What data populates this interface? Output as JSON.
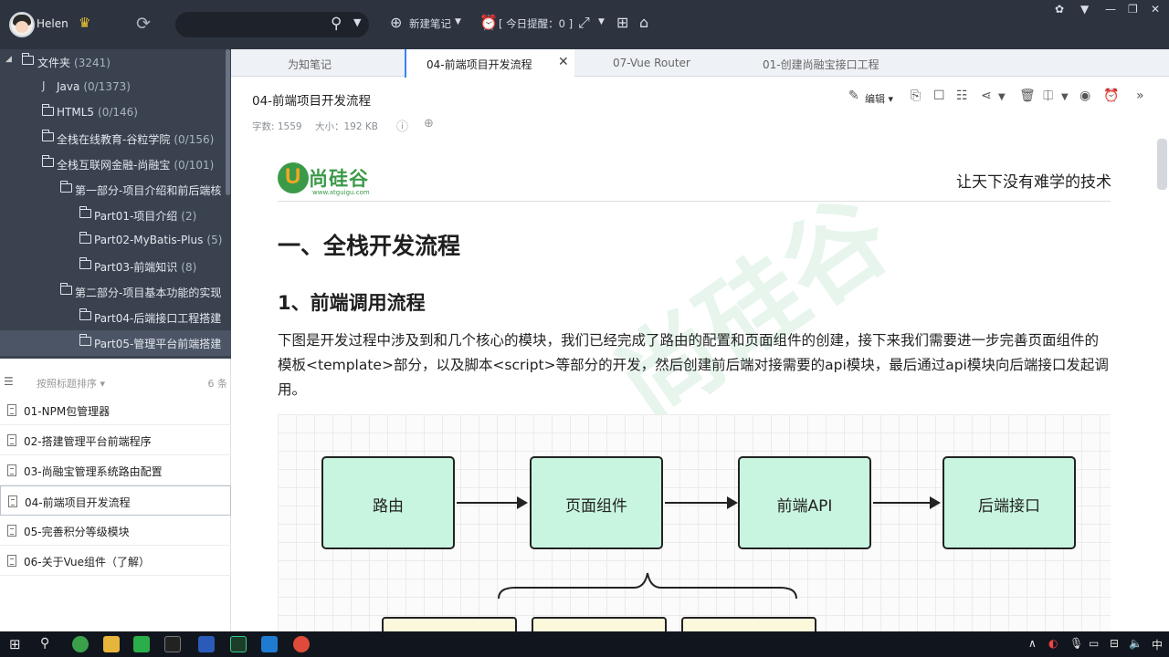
{
  "topbar": {
    "username": "Helen",
    "new_note": "新建笔记",
    "reminder": "[ 今日提醒：0 ]",
    "search_placeholder": ""
  },
  "folders": [
    {
      "label": "文件夹",
      "count": "(3241)"
    },
    {
      "label": "Java",
      "count": "(0/1373)"
    },
    {
      "label": "HTML5",
      "count": "(0/146)"
    },
    {
      "label": "全栈在线教育-谷粒学院",
      "count": "(0/156)"
    },
    {
      "label": "全栈互联网金融-尚融宝",
      "count": "(0/101)"
    },
    {
      "label": "第一部分-项目介绍和前后端核",
      "count": ""
    },
    {
      "label": "Part01-项目介绍",
      "count": "(2)"
    },
    {
      "label": "Part02-MyBatis-Plus",
      "count": "(5)"
    },
    {
      "label": "Part03-前端知识",
      "count": "(8)"
    },
    {
      "label": "第二部分-项目基本功能的实现",
      "count": ""
    },
    {
      "label": "Part04-后端接口工程搭建",
      "count": ""
    },
    {
      "label": "Part05-管理平台前端搭建",
      "count": ""
    }
  ],
  "notelist": {
    "sort_label": "按照标题排序",
    "count": "6 条",
    "items": [
      "01-NPM包管理器",
      "02-搭建管理平台前端程序",
      "03-尚融宝管理系统路由配置",
      "04-前端项目开发流程",
      "05-完善积分等级模块",
      "06-关于Vue组件（了解）"
    ]
  },
  "tabs": [
    "为知笔记",
    "04-前端项目开发流程",
    "07-Vue Router",
    "01-创建尚融宝接口工程"
  ],
  "note": {
    "title": "04-前端项目开发流程",
    "word_count": "字数: 1559",
    "size": "大小：192 KB",
    "edit_label": "编辑"
  },
  "content": {
    "logo_text": "尚硅谷",
    "logo_url": "www.atguigu.com",
    "slogan": "让天下没有难学的技术",
    "h1": "一、全栈开发流程",
    "h2": "1、前端调用流程",
    "para": "下图是开发过程中涉及到和几个核心的模块，我们已经完成了路由的配置和页面组件的创建，接下来我们需要进一步完善页面组件的模板<template>部分，以及脚本<script>等部分的开发，然后创建前后端对接需要的api模块，最后通过api模块向后端接口发起调用。",
    "diagram_boxes": [
      "路由",
      "页面组件",
      "前端API",
      "后端接口"
    ]
  },
  "taskbar": {
    "ime": "中"
  },
  "colors": {
    "topbar_bg": "#2d3440",
    "sidebar_bg": "#3a4250",
    "box_fill": "#c8f5df",
    "accent": "#3b82f6"
  }
}
